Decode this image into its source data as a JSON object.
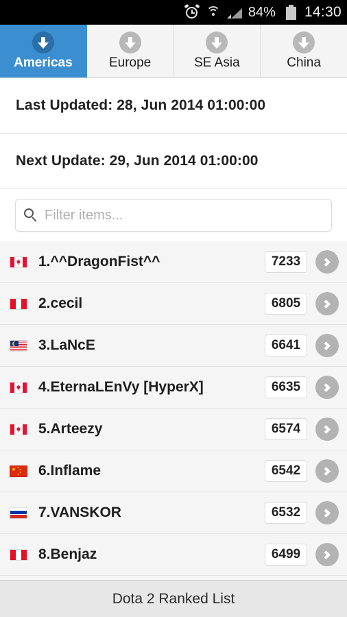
{
  "statusbar": {
    "alarm_icon": "alarm-clock-icon",
    "wifi_icon": "wifi-icon",
    "signal_icon": "cellular-signal-icon",
    "battery_percent": "84%",
    "battery_icon": "battery-icon",
    "time": "14:30"
  },
  "tabs": [
    {
      "label": "Americas",
      "icon": "download-arrow-icon",
      "active": true
    },
    {
      "label": "Europe",
      "icon": "download-arrow-icon",
      "active": false
    },
    {
      "label": "SE Asia",
      "icon": "download-arrow-icon",
      "active": false
    },
    {
      "label": "China",
      "icon": "download-arrow-icon",
      "active": false
    }
  ],
  "info": {
    "last_updated": "Last Updated: 28, Jun 2014 01:00:00",
    "next_update": "Next Update: 29, Jun 2014 01:00:00"
  },
  "search": {
    "icon": "search-icon",
    "placeholder": "Filter items...",
    "value": ""
  },
  "list": {
    "rows": [
      {
        "flag": "ca",
        "flag_name": "flag-canada",
        "name": "1.^^DragonFist^^",
        "score": "7233",
        "chevron": "chevron-right-icon"
      },
      {
        "flag": "pe",
        "flag_name": "flag-peru",
        "name": "2.cecil",
        "score": "6805",
        "chevron": "chevron-right-icon"
      },
      {
        "flag": "my",
        "flag_name": "flag-malaysia",
        "name": "3.LaNcE",
        "score": "6641",
        "chevron": "chevron-right-icon"
      },
      {
        "flag": "ca",
        "flag_name": "flag-canada",
        "name": "4.EternaLEnVy [HyperX]",
        "score": "6635",
        "chevron": "chevron-right-icon"
      },
      {
        "flag": "ca",
        "flag_name": "flag-canada",
        "name": "5.Arteezy",
        "score": "6574",
        "chevron": "chevron-right-icon"
      },
      {
        "flag": "cn",
        "flag_name": "flag-china",
        "name": "6.Inflame",
        "score": "6542",
        "chevron": "chevron-right-icon"
      },
      {
        "flag": "ru",
        "flag_name": "flag-russia",
        "name": "7.VANSKOR",
        "score": "6532",
        "chevron": "chevron-right-icon"
      },
      {
        "flag": "pe",
        "flag_name": "flag-peru",
        "name": "8.Benjaz",
        "score": "6499",
        "chevron": "chevron-right-icon"
      }
    ]
  },
  "footer": {
    "title": "Dota 2 Ranked List"
  },
  "colors": {
    "accent": "#3b8fd1",
    "accent_dark": "#2a6fa8",
    "statusbar_bg": "#000000",
    "tab_inactive_bg": "#f4f4f4",
    "row_bg": "#f5f5f5",
    "footer_bg": "#e7e7e7"
  }
}
